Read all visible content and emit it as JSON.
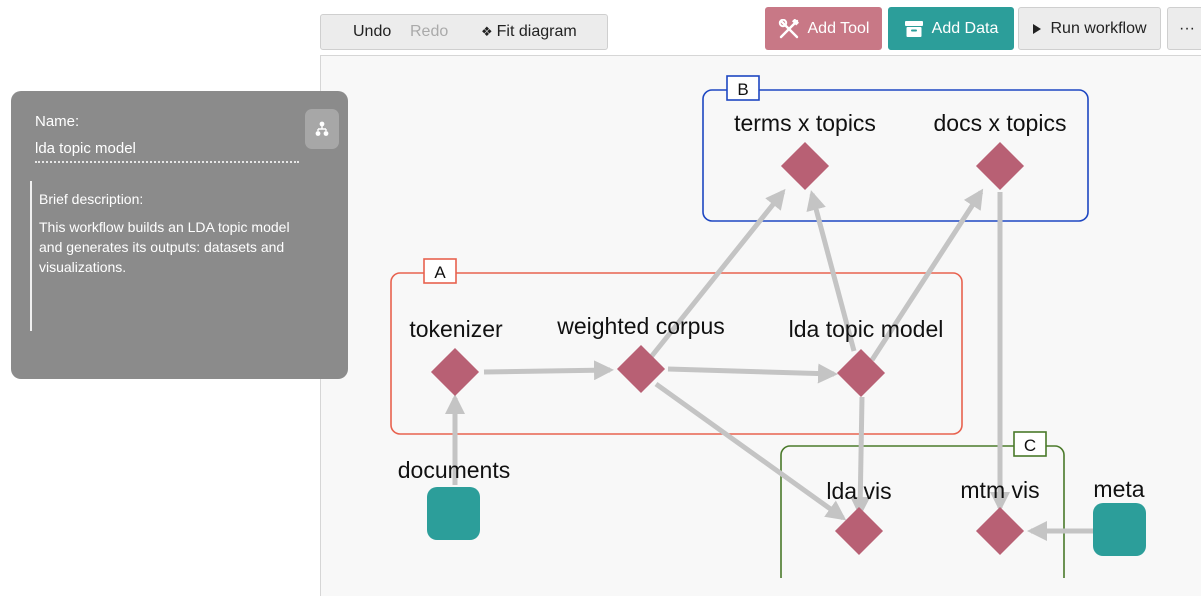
{
  "toolbar": {
    "undo_label": "Undo",
    "redo_label": "Redo",
    "fit_label": "Fit diagram",
    "fit_icon": "diamond-glyph"
  },
  "actions": {
    "add_tool_label": "Add Tool",
    "add_data_label": "Add Data",
    "run_label": "Run workflow",
    "more_label": "···"
  },
  "panel": {
    "name_label": "Name:",
    "name_value": "lda topic model",
    "desc_label": "Brief description:",
    "desc_text": "This workflow builds an LDA topic model and generates its outputs: datasets and visualizations."
  },
  "groups": {
    "a": {
      "label": "A",
      "color": "#e8624f"
    },
    "b": {
      "label": "B",
      "color": "#1e47c2"
    },
    "c": {
      "label": "C",
      "color": "#4a7a2a"
    }
  },
  "nodes": {
    "tokenizer": "tokenizer",
    "weighted_corpus": "weighted corpus",
    "lda_topic_model": "lda topic model",
    "terms_x_topics": "terms x topics",
    "docs_x_topics": "docs x topics",
    "documents": "documents",
    "lda_vis": "lda vis",
    "mtm_vis": "mtm vis",
    "meta": "meta"
  },
  "colors": {
    "tool": "#b86074",
    "data": "#2c9e9a",
    "edge": "#c4c4c4",
    "add_tool": "#c87886",
    "add_data": "#2c9e9a"
  }
}
